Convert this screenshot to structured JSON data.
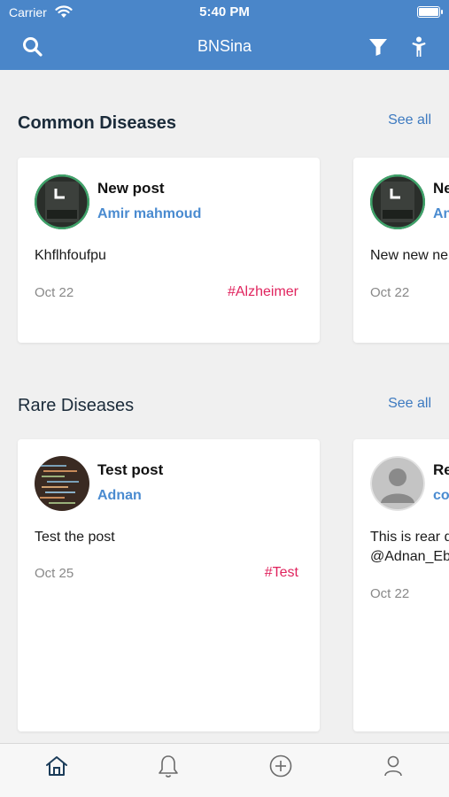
{
  "status_bar": {
    "carrier": "Carrier",
    "time": "5:40 PM"
  },
  "navbar": {
    "title": "BNSina",
    "left_icon": "search-icon",
    "right_icons": [
      "filter-icon",
      "person-icon"
    ]
  },
  "sections": [
    {
      "title": "Common Diseases",
      "see_all": "See all",
      "cards": [
        {
          "title": "New post",
          "author": "Amir mahmoud",
          "body": "Khflhfoufpu",
          "date": "Oct 22",
          "tag": "#Alzheimer"
        },
        {
          "title": "Ne",
          "author": "An",
          "body": "New new ne",
          "date": "Oct 22",
          "tag": ""
        }
      ]
    },
    {
      "title": "Rare Diseases",
      "see_all": "See all",
      "cards": [
        {
          "title": "Test post",
          "author": "Adnan",
          "body": "Test the post",
          "date": "Oct 25",
          "tag": "#Test"
        },
        {
          "title": "Re",
          "author": "coi",
          "body_lines": [
            "This is rear d",
            "@Adnan_Eb"
          ],
          "date": "Oct 22",
          "tag": ""
        }
      ]
    }
  ],
  "tab_bar": {
    "items": [
      "home-icon",
      "bell-icon",
      "add-icon",
      "profile-icon"
    ],
    "active": "home-icon"
  },
  "colors": {
    "nav_bar": "#4a86c9",
    "link": "#3d7ac0",
    "author": "#4a8bd0",
    "tag": "#e0245e",
    "background": "#f0f0f0"
  }
}
